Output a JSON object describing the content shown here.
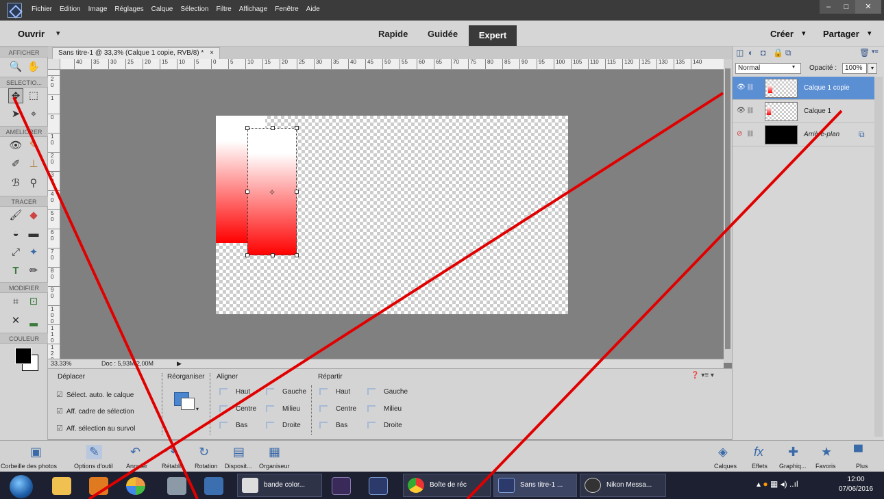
{
  "menu": {
    "items": [
      "Fichier",
      "Edition",
      "Image",
      "Réglages",
      "Calque",
      "Sélection",
      "Filtre",
      "Affichage",
      "Fenêtre",
      "Aide"
    ],
    "window_controls": [
      "–",
      "□",
      "✕"
    ]
  },
  "modebar": {
    "open_label": "Ouvrir",
    "open_arrow": "▾",
    "modes": [
      "Rapide",
      "Guidée",
      "Expert"
    ],
    "create_label": "Créer",
    "create_arrow": "▾",
    "share_label": "Partager",
    "share_arrow": "▾"
  },
  "tools": {
    "sections": [
      "AFFICHER",
      "SELECTIO...",
      "AMELIORER",
      "TRACER",
      "MODIFIER",
      "COULEUR"
    ]
  },
  "document": {
    "tab_title": "Sans titre-1 @ 33,3% (Calque 1 copie, RVB/8) *",
    "tab_close": "×",
    "ruler_h": [
      "40",
      "35",
      "30",
      "25",
      "20",
      "15",
      "10",
      "5",
      "0",
      "5",
      "10",
      "15",
      "20",
      "25",
      "30",
      "35",
      "40",
      "45",
      "50",
      "55",
      "60",
      "65",
      "70",
      "75",
      "80",
      "85",
      "90",
      "95",
      "100",
      "105",
      "110",
      "115",
      "120",
      "125",
      "130",
      "135",
      "140"
    ],
    "ruler_v": [
      "2\n0",
      "1",
      "0",
      "1\n0",
      "2\n0",
      "3\n0",
      "4\n0",
      "5\n0",
      "6\n0",
      "7\n0",
      "8\n0",
      "9\n0",
      "1\n0\n0",
      "1\n1\n0",
      "1\n2\n0"
    ],
    "zoom": "33.33%",
    "doc_size": "Doc : 5,93M/2,00M",
    "status_arrow": "▶"
  },
  "options": {
    "move_title": "Déplacer",
    "checks": [
      "Sélect. auto. le calque",
      "Aff. cadre de sélection",
      "Aff. sélection au survol"
    ],
    "reorg_title": "Réorganiser",
    "align_title": "Aligner",
    "align": [
      "Haut",
      "Gauche",
      "Centre",
      "Milieu",
      "Bas",
      "Droite"
    ],
    "distribute_title": "Répartir",
    "distribute": [
      "Haut",
      "Gauche",
      "Centre",
      "Milieu",
      "Bas",
      "Droite"
    ],
    "help_icons": "❓ ▾≡ ▾"
  },
  "layers": {
    "blend_mode": "Normal",
    "blend_arrow": "▾",
    "opacity_label": "Opacité :",
    "opacity_value": "100%",
    "opacity_arrow": "▾",
    "rows": [
      {
        "name": "Calque 1 copie",
        "selected": true
      },
      {
        "name": "Calque 1",
        "selected": false
      },
      {
        "name": "Arrière-plan",
        "selected": false
      }
    ]
  },
  "bottombar": {
    "left": [
      "Corbeille des photos",
      "Options d'outil",
      "Annuler",
      "Rétablir",
      "Rotation",
      "Disposit...",
      "Organiseur"
    ],
    "right": [
      "Calques",
      "Effets",
      "Graphiq...",
      "Favoris",
      "Plus"
    ]
  },
  "taskbar": {
    "tasks": [
      "bande color...",
      "Boîte de réc",
      "Sans titre-1 ...",
      "Nikon Messa..."
    ],
    "time": "12:00",
    "date": "07/06/2016"
  },
  "colors": {
    "gradient_red": "#ff0000",
    "selected_layer": "#5b8fd4",
    "annotation_red": "#e00000"
  }
}
